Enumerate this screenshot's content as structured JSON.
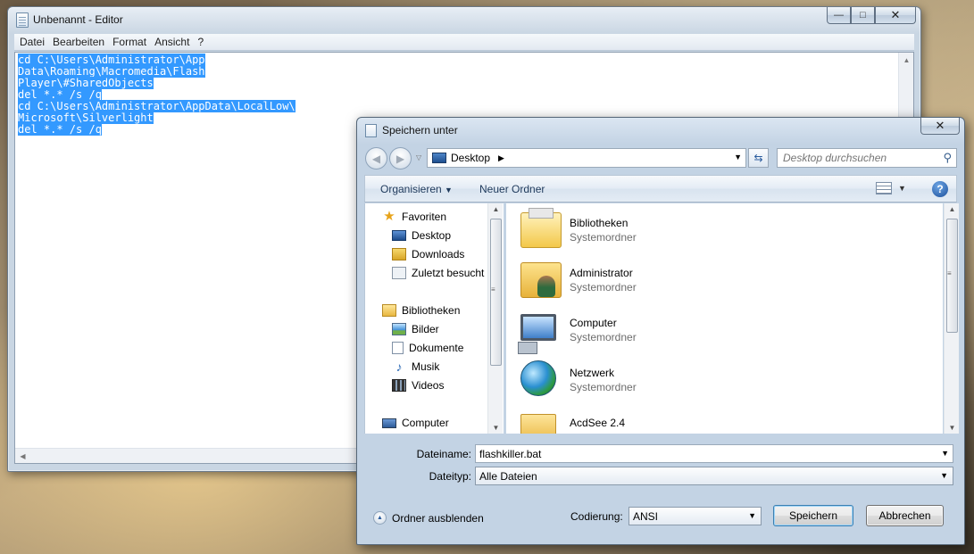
{
  "notepad": {
    "title": "Unbenannt - Editor",
    "menu": [
      "Datei",
      "Bearbeiten",
      "Format",
      "Ansicht",
      "?"
    ],
    "text_lines": [
      "cd C:\\Users\\Administrator\\App",
      "Data\\Roaming\\Macromedia\\Flash",
      "Player\\#SharedObjects",
      "del *.* /s /q",
      "cd C:\\Users\\Administrator\\AppData\\LocalLow\\",
      "Microsoft\\Silverlight",
      "del *.* /s /q"
    ],
    "selection_color": "#3399ff"
  },
  "dialog": {
    "title": "Speichern unter",
    "address": "Desktop",
    "search_placeholder": "Desktop durchsuchen",
    "toolbar": {
      "organize": "Organisieren",
      "new_folder": "Neuer Ordner",
      "help": "?"
    },
    "nav": {
      "favorites": "Favoriten",
      "desktop": "Desktop",
      "downloads": "Downloads",
      "recent": "Zuletzt besucht",
      "libraries": "Bibliotheken",
      "pictures": "Bilder",
      "documents": "Dokumente",
      "music": "Musik",
      "videos": "Videos",
      "computer": "Computer"
    },
    "files": [
      {
        "name": "Bibliotheken",
        "type": "Systemordner",
        "icon": "library-folder-icon"
      },
      {
        "name": "Administrator",
        "type": "Systemordner",
        "icon": "user-folder-icon"
      },
      {
        "name": "Computer",
        "type": "Systemordner",
        "icon": "computer-icon"
      },
      {
        "name": "Netzwerk",
        "type": "Systemordner",
        "icon": "network-icon"
      },
      {
        "name": "AcdSee 2.4",
        "type": "",
        "icon": "folder-icon"
      }
    ],
    "filename_label": "Dateiname:",
    "filename_value": "flashkiller.bat",
    "filetype_label": "Dateityp:",
    "filetype_value": "Alle Dateien",
    "encoding_label": "Codierung:",
    "encoding_value": "ANSI",
    "hide_folders": "Ordner ausblenden",
    "save_label": "Speichern",
    "cancel_label": "Abbrechen"
  }
}
